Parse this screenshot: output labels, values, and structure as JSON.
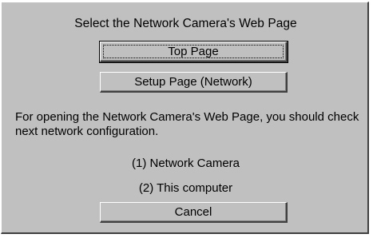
{
  "dialog": {
    "title": "Select the Network Camera's Web Page",
    "buttons": {
      "top_page": "Top Page",
      "setup_page": "Setup Page (Network)",
      "cancel": "Cancel"
    },
    "message": "For opening the Network Camera's Web Page, you should check next network configuration.",
    "items": [
      "(1) Network Camera",
      "(2) This computer"
    ]
  },
  "colors": {
    "dialog_face": "#c0c0c0",
    "highlight": "#ffffff",
    "shadow": "#808080",
    "dark_shadow": "#404040",
    "text": "#000000"
  }
}
